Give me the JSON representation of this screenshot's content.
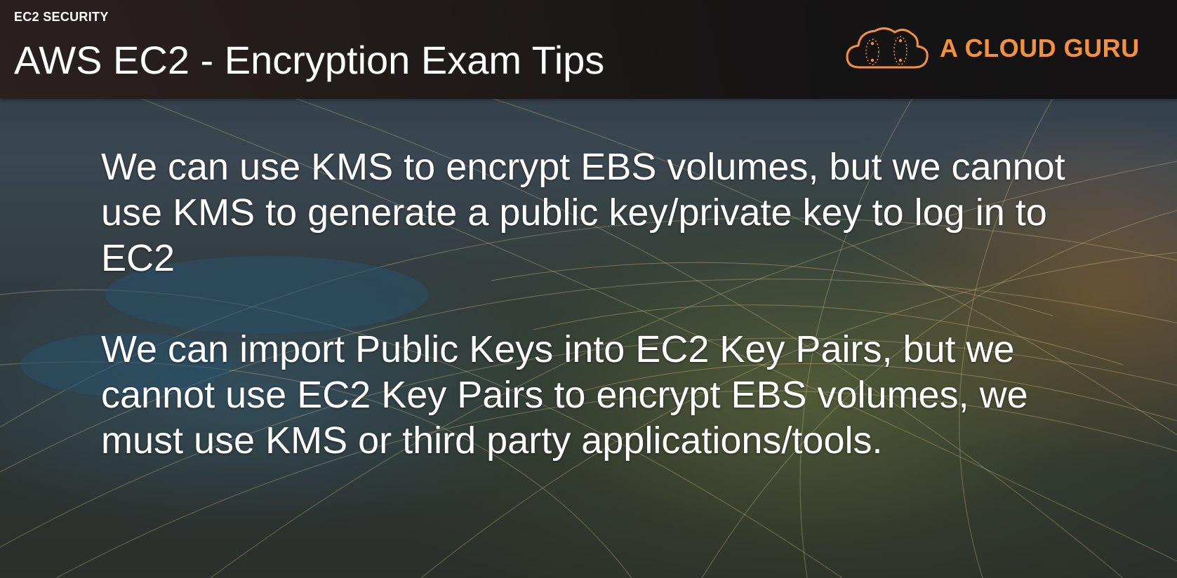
{
  "header": {
    "section": "EC2 SECURITY",
    "title": "AWS EC2 - Encryption Exam Tips"
  },
  "brand": {
    "name": "A CLOUD GURU",
    "logo_icon": "cloud-logo-icon",
    "color": "#f5913b"
  },
  "tips": [
    "We can use KMS to encrypt EBS volumes, but we cannot use KMS to generate a public key/private key to log in to EC2",
    "We can import Public Keys into EC2 Key Pairs, but we cannot use EC2 Key Pairs to encrypt EBS volumes, we must use KMS or third party applications/tools."
  ]
}
